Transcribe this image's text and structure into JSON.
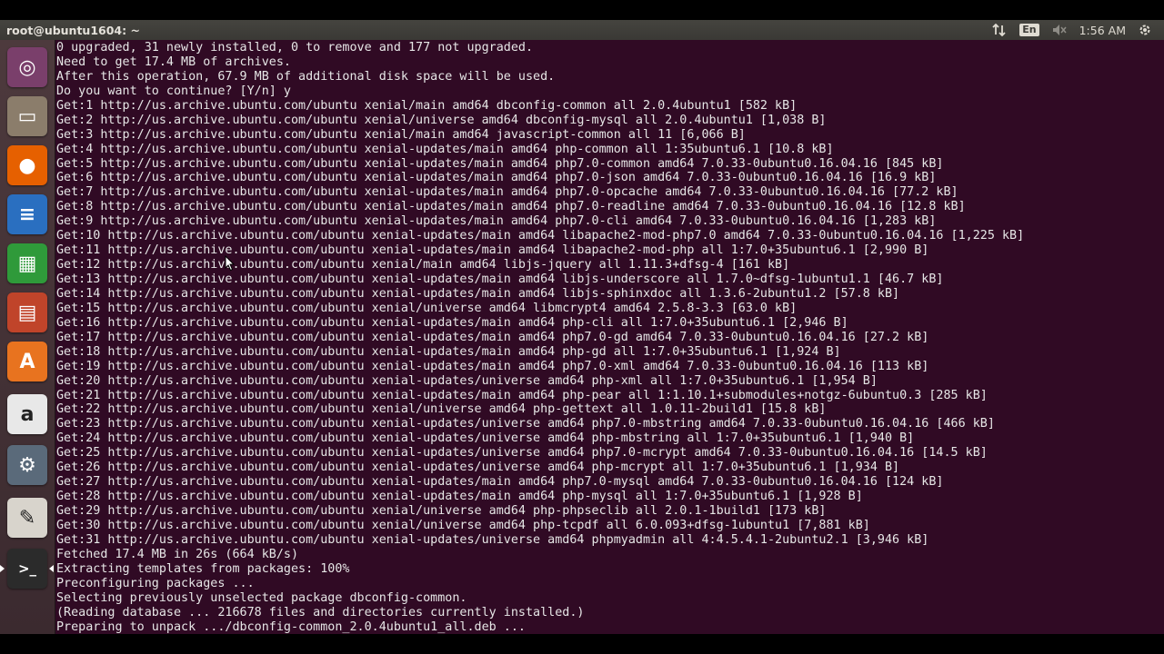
{
  "window": {
    "title": "root@ubuntu1604: ~"
  },
  "tray": {
    "network_icon": "transfer-arrows-icon",
    "language": "En",
    "volume_icon": "volume-muted-icon",
    "clock": "1:56 AM",
    "power_icon": "power-gear-icon"
  },
  "launcher": {
    "items": [
      {
        "name": "ubuntu-dash-icon",
        "glyph": "◎",
        "bg": "#7a3f6b"
      },
      {
        "name": "files-icon",
        "glyph": "▭",
        "bg": "#8b7d6b"
      },
      {
        "name": "firefox-icon",
        "glyph": "●",
        "bg": "#e66000"
      },
      {
        "name": "libreoffice-writer-icon",
        "glyph": "≡",
        "bg": "#2a6fc0"
      },
      {
        "name": "libreoffice-calc-icon",
        "glyph": "▦",
        "bg": "#2f9a3a"
      },
      {
        "name": "libreoffice-impress-icon",
        "glyph": "▤",
        "bg": "#c0442a"
      },
      {
        "name": "software-center-icon",
        "glyph": "A",
        "bg": "#e8731f"
      },
      {
        "name": "amazon-icon",
        "glyph": "a",
        "bg": "#e8e8e8"
      },
      {
        "name": "system-settings-icon",
        "glyph": "⚙",
        "bg": "#5a6a7a"
      },
      {
        "name": "text-editor-icon",
        "glyph": "✎",
        "bg": "#d8d4cc"
      },
      {
        "name": "terminal-icon",
        "glyph": ">_",
        "bg": "#2b2b2b"
      }
    ]
  },
  "terminal": {
    "lines": [
      "0 upgraded, 31 newly installed, 0 to remove and 177 not upgraded.",
      "Need to get 17.4 MB of archives.",
      "After this operation, 67.9 MB of additional disk space will be used.",
      "Do you want to continue? [Y/n] y",
      "Get:1 http://us.archive.ubuntu.com/ubuntu xenial/main amd64 dbconfig-common all 2.0.4ubuntu1 [582 kB]",
      "Get:2 http://us.archive.ubuntu.com/ubuntu xenial/universe amd64 dbconfig-mysql all 2.0.4ubuntu1 [1,038 B]",
      "Get:3 http://us.archive.ubuntu.com/ubuntu xenial/main amd64 javascript-common all 11 [6,066 B]",
      "Get:4 http://us.archive.ubuntu.com/ubuntu xenial-updates/main amd64 php-common all 1:35ubuntu6.1 [10.8 kB]",
      "Get:5 http://us.archive.ubuntu.com/ubuntu xenial-updates/main amd64 php7.0-common amd64 7.0.33-0ubuntu0.16.04.16 [845 kB]",
      "Get:6 http://us.archive.ubuntu.com/ubuntu xenial-updates/main amd64 php7.0-json amd64 7.0.33-0ubuntu0.16.04.16 [16.9 kB]",
      "Get:7 http://us.archive.ubuntu.com/ubuntu xenial-updates/main amd64 php7.0-opcache amd64 7.0.33-0ubuntu0.16.04.16 [77.2 kB]",
      "Get:8 http://us.archive.ubuntu.com/ubuntu xenial-updates/main amd64 php7.0-readline amd64 7.0.33-0ubuntu0.16.04.16 [12.8 kB]",
      "Get:9 http://us.archive.ubuntu.com/ubuntu xenial-updates/main amd64 php7.0-cli amd64 7.0.33-0ubuntu0.16.04.16 [1,283 kB]",
      "Get:10 http://us.archive.ubuntu.com/ubuntu xenial-updates/main amd64 libapache2-mod-php7.0 amd64 7.0.33-0ubuntu0.16.04.16 [1,225 kB]",
      "Get:11 http://us.archive.ubuntu.com/ubuntu xenial-updates/main amd64 libapache2-mod-php all 1:7.0+35ubuntu6.1 [2,990 B]",
      "Get:12 http://us.archive.ubuntu.com/ubuntu xenial/main amd64 libjs-jquery all 1.11.3+dfsg-4 [161 kB]",
      "Get:13 http://us.archive.ubuntu.com/ubuntu xenial-updates/main amd64 libjs-underscore all 1.7.0~dfsg-1ubuntu1.1 [46.7 kB]",
      "Get:14 http://us.archive.ubuntu.com/ubuntu xenial-updates/main amd64 libjs-sphinxdoc all 1.3.6-2ubuntu1.2 [57.8 kB]",
      "Get:15 http://us.archive.ubuntu.com/ubuntu xenial/universe amd64 libmcrypt4 amd64 2.5.8-3.3 [63.0 kB]",
      "Get:16 http://us.archive.ubuntu.com/ubuntu xenial-updates/main amd64 php-cli all 1:7.0+35ubuntu6.1 [2,946 B]",
      "Get:17 http://us.archive.ubuntu.com/ubuntu xenial-updates/main amd64 php7.0-gd amd64 7.0.33-0ubuntu0.16.04.16 [27.2 kB]",
      "Get:18 http://us.archive.ubuntu.com/ubuntu xenial-updates/main amd64 php-gd all 1:7.0+35ubuntu6.1 [1,924 B]",
      "Get:19 http://us.archive.ubuntu.com/ubuntu xenial-updates/main amd64 php7.0-xml amd64 7.0.33-0ubuntu0.16.04.16 [113 kB]",
      "Get:20 http://us.archive.ubuntu.com/ubuntu xenial-updates/universe amd64 php-xml all 1:7.0+35ubuntu6.1 [1,954 B]",
      "Get:21 http://us.archive.ubuntu.com/ubuntu xenial-updates/main amd64 php-pear all 1:1.10.1+submodules+notgz-6ubuntu0.3 [285 kB]",
      "Get:22 http://us.archive.ubuntu.com/ubuntu xenial/universe amd64 php-gettext all 1.0.11-2build1 [15.8 kB]",
      "Get:23 http://us.archive.ubuntu.com/ubuntu xenial-updates/universe amd64 php7.0-mbstring amd64 7.0.33-0ubuntu0.16.04.16 [466 kB]",
      "Get:24 http://us.archive.ubuntu.com/ubuntu xenial-updates/universe amd64 php-mbstring all 1:7.0+35ubuntu6.1 [1,940 B]",
      "Get:25 http://us.archive.ubuntu.com/ubuntu xenial-updates/universe amd64 php7.0-mcrypt amd64 7.0.33-0ubuntu0.16.04.16 [14.5 kB]",
      "Get:26 http://us.archive.ubuntu.com/ubuntu xenial-updates/universe amd64 php-mcrypt all 1:7.0+35ubuntu6.1 [1,934 B]",
      "Get:27 http://us.archive.ubuntu.com/ubuntu xenial-updates/main amd64 php7.0-mysql amd64 7.0.33-0ubuntu0.16.04.16 [124 kB]",
      "Get:28 http://us.archive.ubuntu.com/ubuntu xenial-updates/main amd64 php-mysql all 1:7.0+35ubuntu6.1 [1,928 B]",
      "Get:29 http://us.archive.ubuntu.com/ubuntu xenial/universe amd64 php-phpseclib all 2.0.1-1build1 [173 kB]",
      "Get:30 http://us.archive.ubuntu.com/ubuntu xenial/universe amd64 php-tcpdf all 6.0.093+dfsg-1ubuntu1 [7,881 kB]",
      "Get:31 http://us.archive.ubuntu.com/ubuntu xenial-updates/universe amd64 phpmyadmin all 4:4.5.4.1-2ubuntu2.1 [3,946 kB]",
      "Fetched 17.4 MB in 26s (664 kB/s)",
      "Extracting templates from packages: 100%",
      "Preconfiguring packages ...",
      "Selecting previously unselected package dbconfig-common.",
      "(Reading database ... 216678 files and directories currently installed.)",
      "Preparing to unpack .../dbconfig-common_2.0.4ubuntu1_all.deb ..."
    ]
  }
}
